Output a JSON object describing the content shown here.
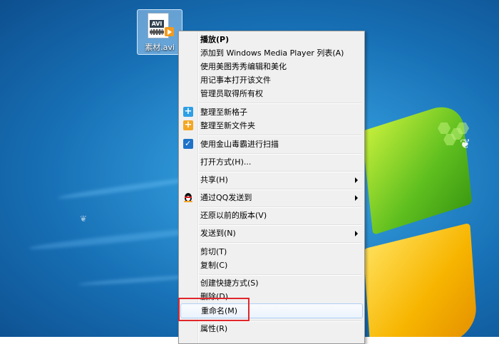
{
  "desktop_file": {
    "name": "素材.avi",
    "type_badge": "AVI"
  },
  "context_menu": {
    "items": [
      {
        "label": "播放(P)",
        "bold": true
      },
      {
        "label": "添加到 Windows Media Player 列表(A)"
      },
      {
        "label": "使用美图秀秀编辑和美化"
      },
      {
        "label": "用记事本打开该文件"
      },
      {
        "label": "管理员取得所有权"
      },
      {
        "label": "整理至新格子",
        "icon": "plus-blue-icon"
      },
      {
        "label": "整理至新文件夹",
        "icon": "plus-orange-icon"
      },
      {
        "label": "使用金山毒霸进行扫描",
        "icon": "shield-icon"
      },
      {
        "label": "打开方式(H)..."
      },
      {
        "label": "共享(H)",
        "submenu": true
      },
      {
        "label": "通过QQ发送到",
        "icon": "qq-penguin-icon",
        "submenu": true
      },
      {
        "label": "还原以前的版本(V)"
      },
      {
        "label": "发送到(N)",
        "submenu": true
      },
      {
        "label": "剪切(T)"
      },
      {
        "label": "复制(C)"
      },
      {
        "label": "创建快捷方式(S)"
      },
      {
        "label": "删除(D)"
      },
      {
        "label": "重命名(M)",
        "highlighted": true
      },
      {
        "label": "属性(R)"
      }
    ]
  },
  "colors": {
    "highlight_box": "#e0262a",
    "menu_bg": "#f0f0f0",
    "desktop_blue": "#1e7fc4"
  }
}
